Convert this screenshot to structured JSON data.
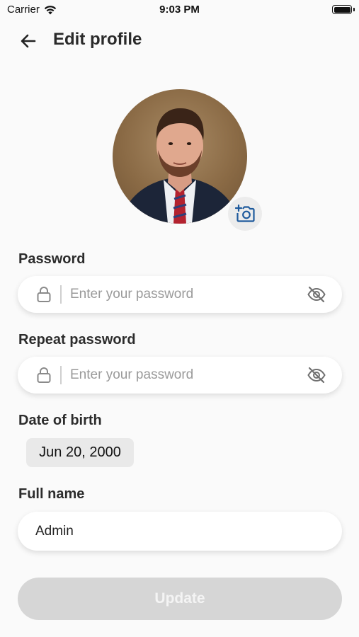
{
  "status_bar": {
    "carrier": "Carrier",
    "time": "9:03 PM"
  },
  "header": {
    "title": "Edit profile"
  },
  "fields": {
    "password": {
      "label": "Password",
      "placeholder": "Enter your password"
    },
    "repeat_password": {
      "label": "Repeat password",
      "placeholder": "Enter your password"
    },
    "date_of_birth": {
      "label": "Date of birth",
      "value": "Jun 20, 2000"
    },
    "full_name": {
      "label": "Full name",
      "value": "Admin"
    }
  },
  "buttons": {
    "update": "Update"
  },
  "icons": {
    "back": "arrow-left-icon",
    "camera": "add-photo-icon",
    "lock": "lock-icon",
    "visibility": "eye-off-icon"
  },
  "colors": {
    "accent": "#1e5a9c",
    "disabled_button": "#d6d6d6",
    "background": "#fafafa"
  }
}
